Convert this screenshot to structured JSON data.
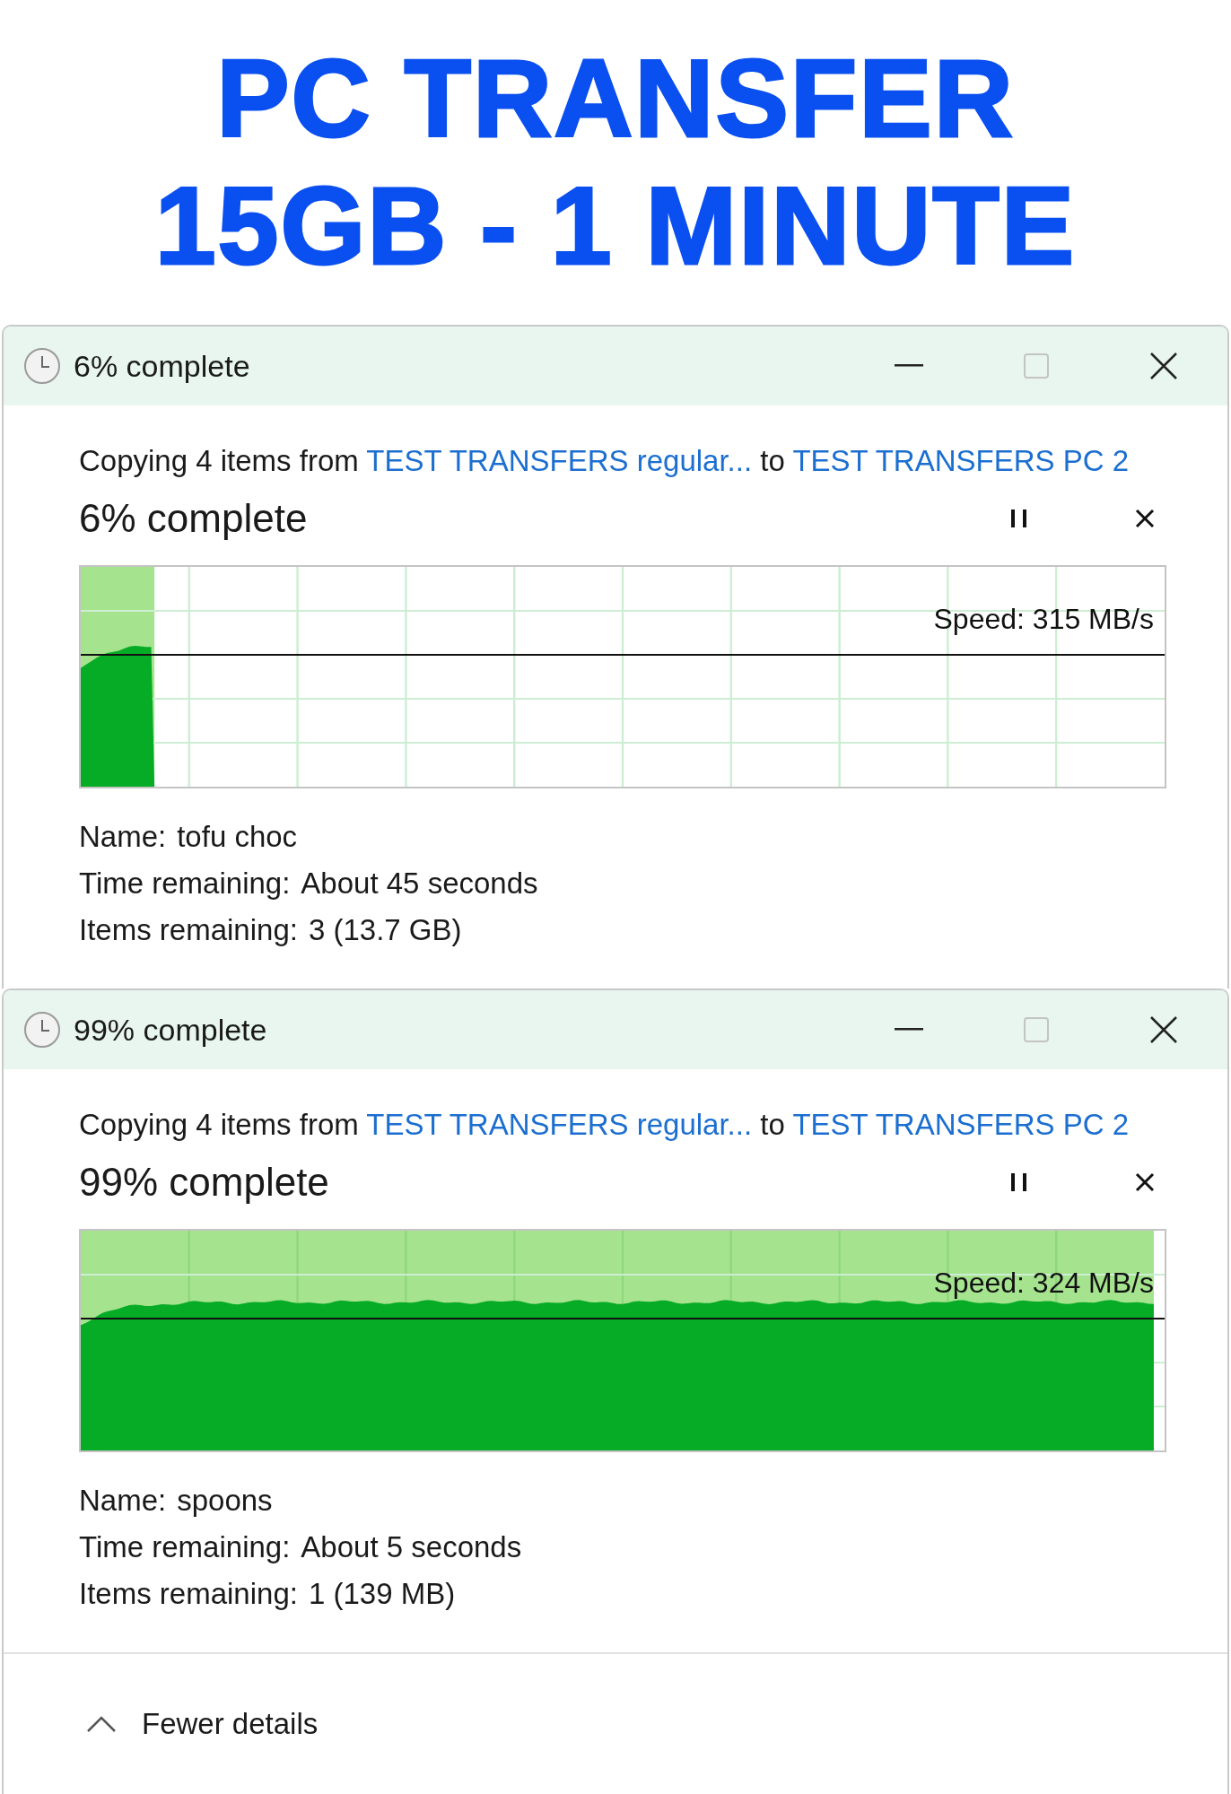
{
  "banner": {
    "lines": [
      "PC TRANSFER",
      "15GB - 1 MINUTE"
    ]
  },
  "dialogs": [
    {
      "title": "6% complete",
      "copying": "Copying 4 items from",
      "source": "TEST TRANSFERS regular...",
      "to": "to",
      "destination": "TEST TRANSFERS PC 2",
      "heading": "6% complete",
      "progress": {
        "level": 0.068,
        "speed": "Speed: 315 MB/s"
      },
      "details": [
        {
          "label": "Name:",
          "value": "tofu choc"
        },
        {
          "label": "Time remaining:",
          "value": "About 45 seconds"
        },
        {
          "label": "Items remaining:",
          "value": "3 (13.7 GB)"
        }
      ]
    },
    {
      "title": "99% complete",
      "copying": "Copying 4 items from",
      "source": "TEST TRANSFERS regular...",
      "to": "to",
      "destination": "TEST TRANSFERS PC 2",
      "heading": "99% complete",
      "progress": {
        "level": 0.99,
        "speed": "Speed: 324 MB/s"
      },
      "details": [
        {
          "label": "Name:",
          "value": "spoons"
        },
        {
          "label": "Time remaining:",
          "value": "About 5 seconds"
        },
        {
          "label": "Items remaining:",
          "value": "1 (139 MB)"
        }
      ],
      "footer": {
        "toggle": "Fewer details",
        "expanded": true
      }
    }
  ]
}
